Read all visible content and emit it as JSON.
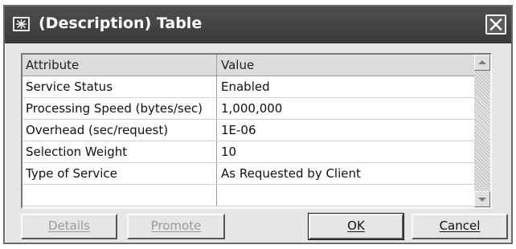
{
  "window": {
    "title": "(Description) Table"
  },
  "table": {
    "columns": [
      "Attribute",
      "Value"
    ],
    "rows": [
      {
        "attribute": "Service Status",
        "value": "Enabled"
      },
      {
        "attribute": "Processing Speed (bytes/sec)",
        "value": "1,000,000"
      },
      {
        "attribute": "Overhead (sec/request)",
        "value": "1E-06"
      },
      {
        "attribute": "Selection Weight",
        "value": "10"
      },
      {
        "attribute": "Type of Service",
        "value": "As Requested by Client"
      },
      {
        "attribute": "",
        "value": ""
      }
    ]
  },
  "buttons": {
    "details": "Details",
    "promote": "Promote",
    "ok": "OK",
    "cancel": "Cancel"
  },
  "icons": {
    "app": "star-app-icon",
    "close": "close-icon",
    "scroll_up": "arrow-up-icon",
    "scroll_down": "arrow-down-icon"
  },
  "colors": {
    "titlebar": "#3a3a3a",
    "window_bg": "#e6e6e6",
    "disabled_text": "#9a9a9a"
  }
}
